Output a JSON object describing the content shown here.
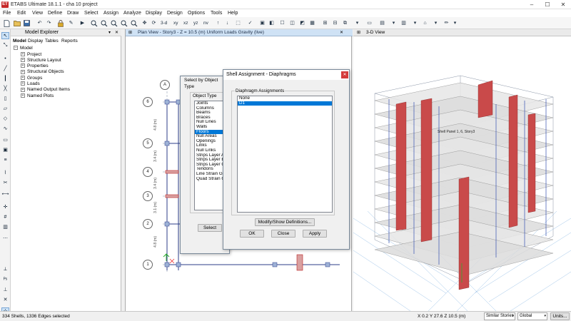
{
  "window": {
    "app_icon": "ET",
    "title": "ETABS Ultimate 18.1.1 - cha 10 project",
    "minimize": "–",
    "maximize": "☐",
    "close": "✕"
  },
  "menu": [
    "File",
    "Edit",
    "View",
    "Define",
    "Draw",
    "Select",
    "Assign",
    "Analyze",
    "Display",
    "Design",
    "Options",
    "Tools",
    "Help"
  ],
  "toolbar": {
    "view_3d": "3-d",
    "view_xy": "xy",
    "view_xz": "xz",
    "view_yz": "yz",
    "nv": "nv",
    "icons": [
      "new-file-icon",
      "open-folder-icon",
      "save-icon",
      "undo-icon",
      "redo-icon",
      "lock-icon",
      "pencil-icon",
      "run-analysis-icon",
      "zoom-out-icon",
      "zoom-in-icon",
      "zoom-window-icon",
      "zoom-extent-icon",
      "pan-icon",
      "refresh-icon"
    ]
  },
  "explorer": {
    "title": "Model Explorer",
    "tabs": [
      "Model",
      "Display",
      "Tables",
      "Reports"
    ],
    "root": "Model",
    "items": [
      "Project",
      "Structure Layout",
      "Properties",
      "Structural Objects",
      "Groups",
      "Loads",
      "Named Output Items",
      "Named Plots"
    ]
  },
  "plan": {
    "title": "Plan View - Story3 - Z = 10.5 (m)  Uniform Loads Gravity  (live)",
    "grid_top": "A",
    "grid_rows": [
      "6",
      "5",
      "4",
      "3",
      "2",
      "1"
    ],
    "dims": [
      "4.8 (m)",
      "3.4 (m)",
      "3.4 (m)",
      "3.1 (m)",
      "4.8 (m)"
    ]
  },
  "view3d": {
    "title": "3-D View",
    "label": "Shell Panel 1, 6, Story3"
  },
  "select_dialog": {
    "title": "Select by Object Type",
    "group_label": "Object Type",
    "items": [
      "Joints",
      "Columns",
      "Beams",
      "Braces",
      "Null Lines",
      "Walls",
      "Floors",
      "Null Areas",
      "Openings",
      "Links",
      "Null Links",
      "Strips Layer A",
      "Strips Layer B",
      "Strips Layer Oth",
      "Tendons",
      "Line Strain Gau",
      "Quad Strain Ga"
    ],
    "selected": "Floors",
    "select_button": "Select"
  },
  "shell_dialog": {
    "title": "Shell Assignment - Diaphragms",
    "group_label": "Diaphragm Assignments",
    "items": [
      "None",
      "D1"
    ],
    "selected": "D1",
    "modify_button": "Modify/Show Definitions...",
    "ok": "OK",
    "close": "Close",
    "apply": "Apply",
    "close_x": "✕"
  },
  "status": {
    "left": "334 Shells, 1336 Edges selected",
    "coords": "X 0.2  Y 27.6  Z 10.5 (m)",
    "stories": "Similar Stories",
    "coord_sys": "Global",
    "units": "Units..."
  },
  "colors": {
    "accent": "#0078d7",
    "wall_red": "#c94a4a",
    "plan_tab": "#cfe2f5",
    "app_icon": "#c62828"
  }
}
